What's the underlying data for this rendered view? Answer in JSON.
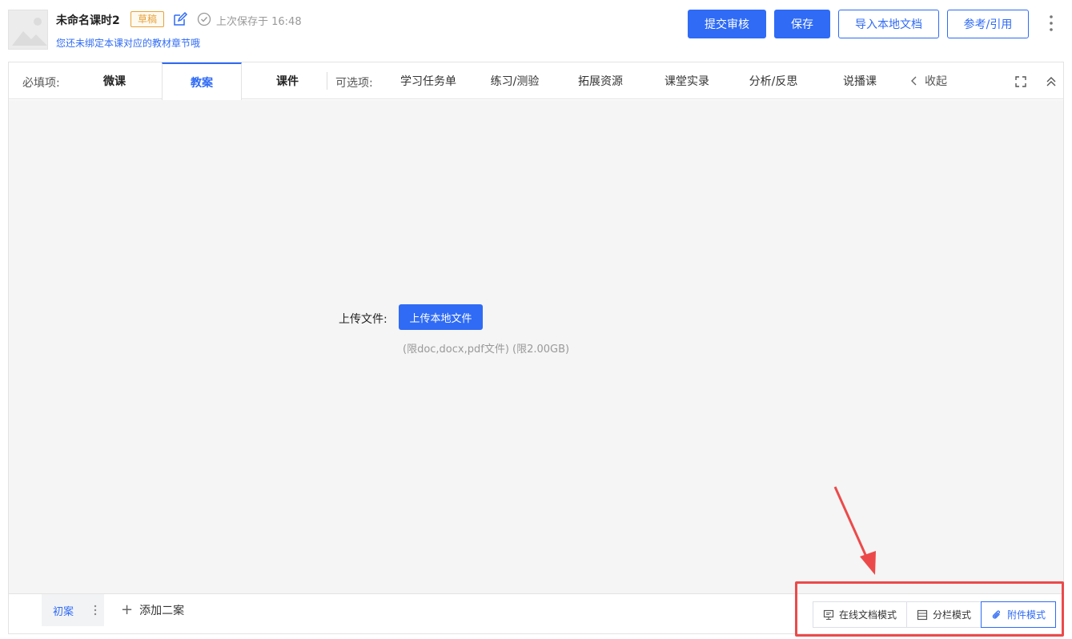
{
  "header": {
    "title": "未命名课时2",
    "status_badge": "草稿",
    "saved_text": "上次保存于 16:48",
    "bind_hint": "您还未绑定本课对应的教材章节哦",
    "buttons": {
      "submit": "提交审核",
      "save": "保存",
      "import": "导入本地文档",
      "reference": "参考/引用"
    }
  },
  "tabbar": {
    "required_label": "必填项:",
    "optional_label": "可选项:",
    "required_tabs": [
      "微课",
      "教案",
      "课件"
    ],
    "optional_tabs": [
      "学习任务单",
      "练习/测验",
      "拓展资源",
      "课堂实录",
      "分析/反思",
      "说播课"
    ],
    "active_tab": "教案",
    "collapse_label": "收起"
  },
  "upload": {
    "label": "上传文件:",
    "button": "上传本地文件",
    "limit_text": "(限doc,docx,pdf文件)  (限2.00GB)"
  },
  "bottombar": {
    "draft_tab": "初案",
    "add_plan": "添加二案",
    "modes": [
      "在线文档模式",
      "分栏模式",
      "附件模式"
    ],
    "active_mode": "附件模式"
  },
  "colors": {
    "primary": "#2f6bf5",
    "draft_badge": "#e6a23c",
    "annotation": "#ec4a4a",
    "content_bg": "#f5f5f5"
  }
}
